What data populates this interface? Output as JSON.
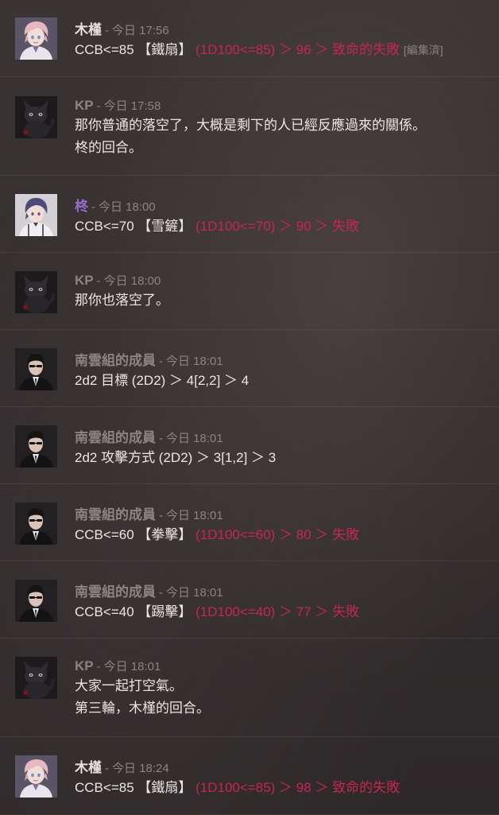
{
  "messages": [
    {
      "author": "木槿",
      "author_color": "#e6e1df",
      "avatar_icon": "mujin-avatar-icon",
      "separator": "-",
      "timestamp": "今日 17:56",
      "lines": [
        {
          "cmd": "CCB<=85 【鐵扇】",
          "result": "(1D100<=85) ＞ 96 ＞ 致命的失敗",
          "note": "[編集済]"
        }
      ]
    },
    {
      "author": "KP",
      "author_color": "#8b8482",
      "avatar_icon": "black-cat-avatar-icon",
      "separator": "-",
      "timestamp": "今日 17:58",
      "lines": [
        {
          "text": "那你普通的落空了，大概是剩下的人已經反應過來的關係。"
        },
        {
          "text": "柊的回合。"
        }
      ]
    },
    {
      "author": "柊",
      "author_color": "#9a6ec8",
      "avatar_icon": "hiiragi-avatar-icon",
      "separator": "-",
      "timestamp": "今日 18:00",
      "lines": [
        {
          "cmd": "CCB<=70 【雪鏟】",
          "result": "(1D100<=70) ＞ 90 ＞ 失敗"
        }
      ]
    },
    {
      "author": "KP",
      "author_color": "#8b8482",
      "avatar_icon": "black-cat-avatar-icon",
      "separator": "-",
      "timestamp": "今日 18:00",
      "lines": [
        {
          "text": "那你也落空了。"
        }
      ]
    },
    {
      "author": "南雲組的成員",
      "author_color": "#8b8482",
      "avatar_icon": "suit-man-avatar-icon",
      "separator": "-",
      "timestamp": "今日 18:01",
      "lines": [
        {
          "text": "2d2 目標 (2D2) ＞ 4[2,2] ＞ 4"
        }
      ]
    },
    {
      "author": "南雲組的成員",
      "author_color": "#8b8482",
      "avatar_icon": "suit-man-avatar-icon",
      "separator": "-",
      "timestamp": "今日 18:01",
      "lines": [
        {
          "text": "2d2 攻擊方式 (2D2) ＞ 3[1,2] ＞ 3"
        }
      ]
    },
    {
      "author": "南雲組的成員",
      "author_color": "#8b8482",
      "avatar_icon": "suit-man-avatar-icon",
      "separator": "-",
      "timestamp": "今日 18:01",
      "lines": [
        {
          "cmd": "CCB<=60 【拳擊】",
          "result": "(1D100<=60) ＞ 80 ＞ 失敗"
        }
      ]
    },
    {
      "author": "南雲組的成員",
      "author_color": "#8b8482",
      "avatar_icon": "suit-man-avatar-icon",
      "separator": "-",
      "timestamp": "今日 18:01",
      "lines": [
        {
          "cmd": "CCB<=40 【踢擊】",
          "result": "(1D100<=40) ＞ 77 ＞ 失敗"
        }
      ]
    },
    {
      "author": "KP",
      "author_color": "#8b8482",
      "avatar_icon": "black-cat-avatar-icon",
      "separator": "-",
      "timestamp": "今日 18:01",
      "lines": [
        {
          "text": "大家一起打空氣。"
        },
        {
          "text": "第三輪，木槿的回合。"
        }
      ]
    },
    {
      "author": "木槿",
      "author_color": "#e6e1df",
      "avatar_icon": "mujin-avatar-icon",
      "separator": "-",
      "timestamp": "今日 18:24",
      "lines": [
        {
          "cmd": "CCB<=85 【鐵扇】",
          "result": "(1D100<=85) ＞ 98 ＞ 致命的失敗"
        }
      ]
    }
  ]
}
